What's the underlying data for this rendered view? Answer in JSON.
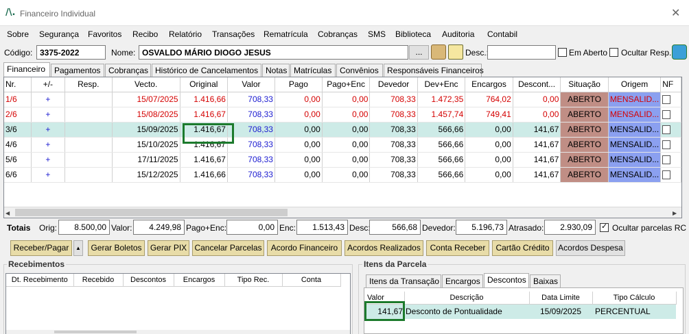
{
  "window": {
    "title": "Financeiro Individual",
    "logo": "/\\.",
    "close": "✕"
  },
  "menu": [
    "Sobre",
    "Segurança",
    "Favoritos",
    "Recibo",
    "Relatório",
    "Transações",
    "Rematrícula",
    "Cobranças",
    "SMS",
    "Biblioteca",
    "Auditoria",
    "Contabil"
  ],
  "header": {
    "codigo_label": "Código:",
    "codigo_value": "3375-2022",
    "nome_label": "Nome:",
    "nome_value": "OSVALDO MÁRIO DIOGO JESUS",
    "ellipsis": "...",
    "desc_label": "Desc.:",
    "desc_value": "",
    "em_aberto": "Em Aberto",
    "ocultar_resp": "Ocultar Resp."
  },
  "tabs": [
    "Financeiro",
    "Pagamentos",
    "Cobranças",
    "Histórico de Cancelamentos",
    "Notas",
    "Matrículas",
    "Convênios",
    "Responsáveis Financeiros"
  ],
  "grid": {
    "columns": [
      "Nr.",
      "+/-",
      "Resp.",
      "Vecto.",
      "Original",
      "Valor",
      "Pago",
      "Pago+Enc",
      "Devedor",
      "Dev+Enc",
      "Encargos",
      "Descont...",
      "Situação",
      "Origem",
      "NF"
    ],
    "rows": [
      {
        "nr": "1/6",
        "pm": "+",
        "resp": "",
        "vecto": "15/07/2025",
        "original": "1.416,66",
        "valor": "708,33",
        "pago": "0,00",
        "pagoenc": "0,00",
        "devedor": "708,33",
        "devenc": "1.472,35",
        "encargos": "764,02",
        "desconto": "0,00",
        "situacao": "ABERTO",
        "origem": "MENSALID...",
        "color": "red"
      },
      {
        "nr": "2/6",
        "pm": "+",
        "resp": "",
        "vecto": "15/08/2025",
        "original": "1.416,67",
        "valor": "708,33",
        "pago": "0,00",
        "pagoenc": "0,00",
        "devedor": "708,33",
        "devenc": "1.457,74",
        "encargos": "749,41",
        "desconto": "0,00",
        "situacao": "ABERTO",
        "origem": "MENSALID...",
        "color": "red"
      },
      {
        "nr": "3/6",
        "pm": "+",
        "resp": "",
        "vecto": "15/09/2025",
        "original": "1.416,67",
        "valor": "708,33",
        "pago": "0,00",
        "pagoenc": "0,00",
        "devedor": "708,33",
        "devenc": "566,66",
        "encargos": "0,00",
        "desconto": "141,67",
        "situacao": "ABERTO",
        "origem": "MENSALID...",
        "color": "black"
      },
      {
        "nr": "4/6",
        "pm": "+",
        "resp": "",
        "vecto": "15/10/2025",
        "original": "1.416,67",
        "valor": "708,33",
        "pago": "0,00",
        "pagoenc": "0,00",
        "devedor": "708,33",
        "devenc": "566,66",
        "encargos": "0,00",
        "desconto": "141,67",
        "situacao": "ABERTO",
        "origem": "MENSALID...",
        "color": "black"
      },
      {
        "nr": "5/6",
        "pm": "+",
        "resp": "",
        "vecto": "17/11/2025",
        "original": "1.416,67",
        "valor": "708,33",
        "pago": "0,00",
        "pagoenc": "0,00",
        "devedor": "708,33",
        "devenc": "566,66",
        "encargos": "0,00",
        "desconto": "141,67",
        "situacao": "ABERTO",
        "origem": "MENSALID...",
        "color": "black"
      },
      {
        "nr": "6/6",
        "pm": "+",
        "resp": "",
        "vecto": "15/12/2025",
        "original": "1.416,66",
        "valor": "708,33",
        "pago": "0,00",
        "pagoenc": "0,00",
        "devedor": "708,33",
        "devenc": "566,66",
        "encargos": "0,00",
        "desconto": "141,67",
        "situacao": "ABERTO",
        "origem": "MENSALID...",
        "color": "black"
      }
    ]
  },
  "totals": {
    "label": "Totais",
    "orig_label": "Orig:",
    "orig": "8.500,00",
    "valor_label": "Valor:",
    "valor": "4.249,98",
    "pagoenc_label": "Pago+Enc:",
    "pagoenc": "0,00",
    "enc_label": "Enc:",
    "enc": "1.513,43",
    "desc_label": "Desc:",
    "desc": "566,68",
    "devedor_label": "Devedor:",
    "devedor": "5.196,73",
    "atrasado_label": "Atrasado:",
    "atrasado": "2.930,09",
    "ocultar": "Ocultar parcelas RC"
  },
  "actions": [
    "Receber/Pagar",
    "Gerar Boletos",
    "Gerar PIX",
    "Cancelar Parcelas",
    "Acordo Financeiro",
    "Acordos Realizados",
    "Conta Receber",
    "Cartão Crédito",
    "Acordos Despesa"
  ],
  "recebimentos": {
    "title": "Recebimentos",
    "columns": [
      "Dt. Recebimento",
      "Recebido",
      "Descontos",
      "Encargos",
      "Tipo Rec.",
      "Conta"
    ]
  },
  "itens": {
    "title": "Itens da Parcela",
    "tabs": [
      "Itens da Transação",
      "Encargos",
      "Descontos",
      "Baixas"
    ],
    "columns": [
      "Valor",
      "Descrição",
      "Data Limite",
      "Tipo Cálculo"
    ],
    "row": {
      "valor": "141,67",
      "descricao": "Desconto de Pontualidade",
      "data": "15/09/2025",
      "tipo": "PERCENTUAL"
    }
  }
}
